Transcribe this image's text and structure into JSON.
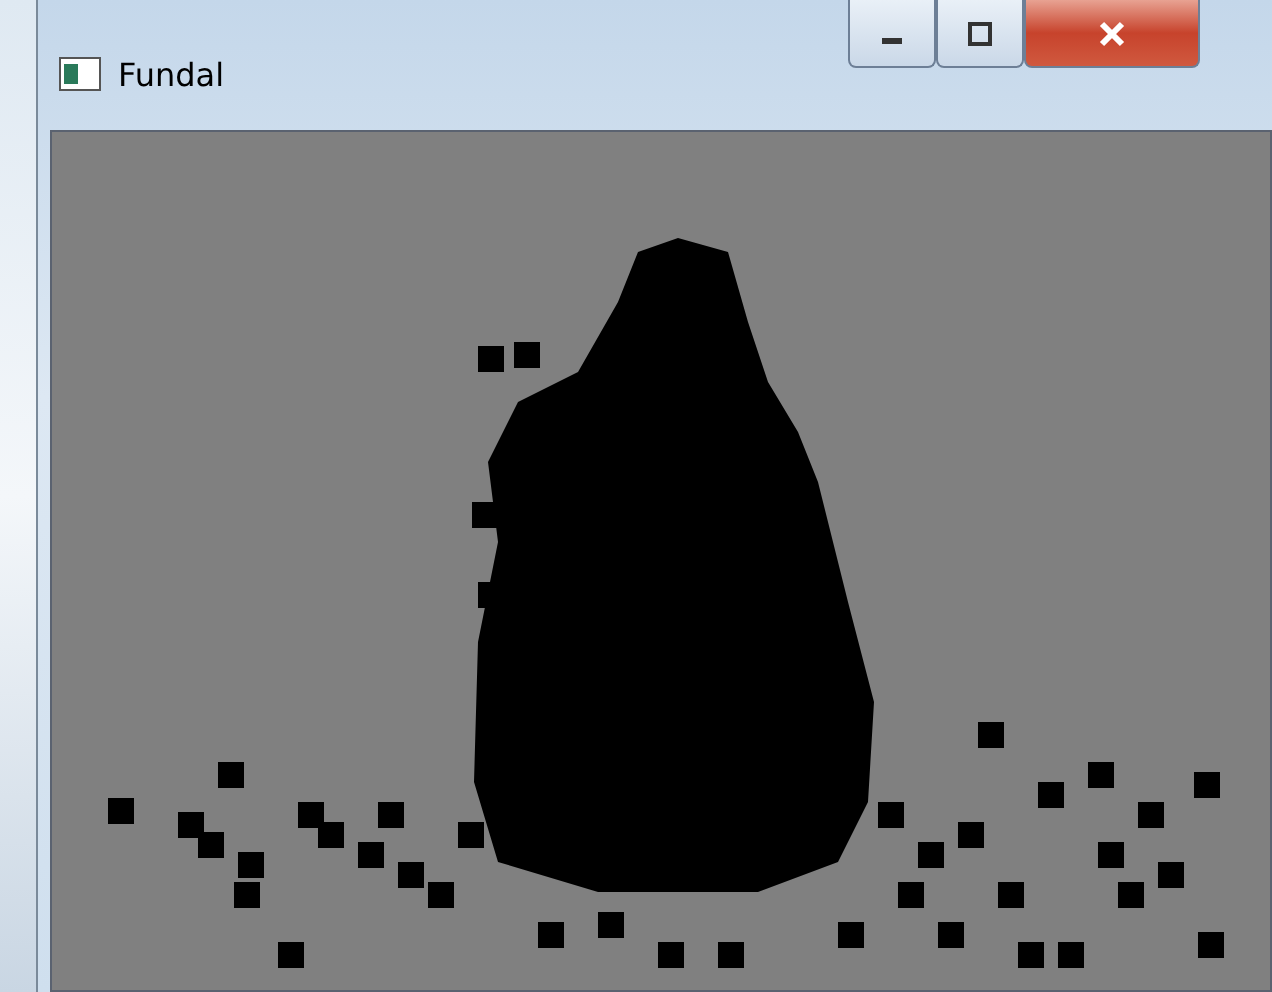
{
  "window": {
    "title": "Fundal"
  }
}
